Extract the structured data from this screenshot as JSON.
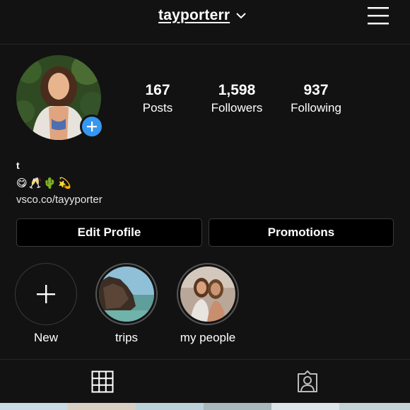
{
  "header": {
    "username": "tayporterr",
    "icons": {
      "dropdown": "chevron-down-icon",
      "menu": "hamburger-menu-icon"
    }
  },
  "profile": {
    "stats": [
      {
        "value": "167",
        "label": "Posts"
      },
      {
        "value": "1,598",
        "label": "Followers"
      },
      {
        "value": "937",
        "label": "Following"
      }
    ],
    "bio": {
      "name": "t",
      "emojis": "😋🥂🌵💫",
      "link": "vsco.co/tayyporter"
    }
  },
  "actions": {
    "edit_profile": "Edit Profile",
    "promotions": "Promotions"
  },
  "highlights": [
    {
      "label": "New"
    },
    {
      "label": "trips"
    },
    {
      "label": "my people"
    }
  ],
  "tabs": {
    "grid": "grid-icon",
    "tagged": "tagged-person-icon"
  },
  "colors": {
    "background": "#121212",
    "accent": "#3797f0",
    "border": "#3a3a3a"
  }
}
